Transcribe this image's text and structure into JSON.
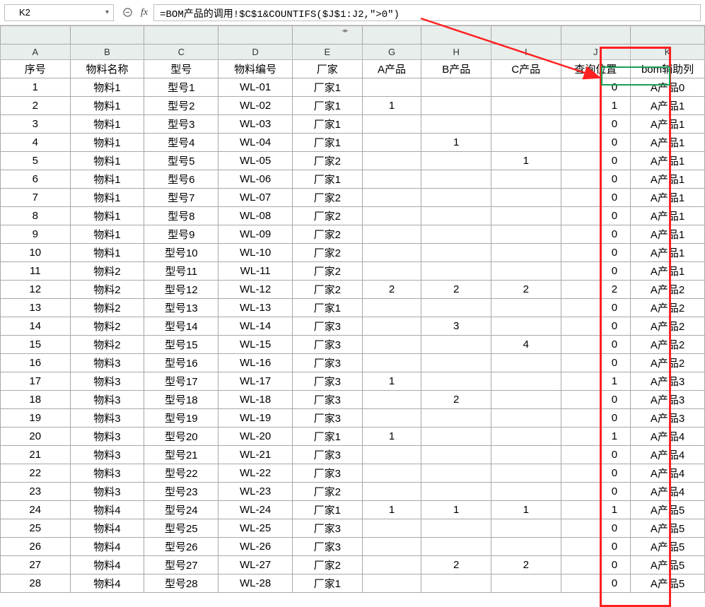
{
  "formula_bar": {
    "cell_ref": "K2",
    "fx_label": "fx",
    "formula": "=BOM产品的调用!$C$1&COUNTIFS($J$1:J2,\">0\")"
  },
  "columns": {
    "A": "A",
    "B": "B",
    "C": "C",
    "D": "D",
    "E": "E",
    "G": "G",
    "H": "H",
    "I": "I",
    "J": "J",
    "K": "K"
  },
  "headers": {
    "A": "序号",
    "B": "物料名称",
    "C": "型号",
    "D": "物料编号",
    "E": "厂家",
    "G": "A产品",
    "H": "B产品",
    "I": "C产品",
    "J": "查询位置",
    "K": "bom辅助列"
  },
  "rows": [
    {
      "A": "1",
      "B": "物料1",
      "C": "型号1",
      "D": "WL-01",
      "E": "厂家1",
      "G": "",
      "H": "",
      "I": "",
      "J": "0",
      "K": "A产品0"
    },
    {
      "A": "2",
      "B": "物料1",
      "C": "型号2",
      "D": "WL-02",
      "E": "厂家1",
      "G": "1",
      "H": "",
      "I": "",
      "J": "1",
      "K": "A产品1"
    },
    {
      "A": "3",
      "B": "物料1",
      "C": "型号3",
      "D": "WL-03",
      "E": "厂家1",
      "G": "",
      "H": "",
      "I": "",
      "J": "0",
      "K": "A产品1"
    },
    {
      "A": "4",
      "B": "物料1",
      "C": "型号4",
      "D": "WL-04",
      "E": "厂家1",
      "G": "",
      "H": "1",
      "I": "",
      "J": "0",
      "K": "A产品1"
    },
    {
      "A": "5",
      "B": "物料1",
      "C": "型号5",
      "D": "WL-05",
      "E": "厂家2",
      "G": "",
      "H": "",
      "I": "1",
      "J": "0",
      "K": "A产品1"
    },
    {
      "A": "6",
      "B": "物料1",
      "C": "型号6",
      "D": "WL-06",
      "E": "厂家1",
      "G": "",
      "H": "",
      "I": "",
      "J": "0",
      "K": "A产品1"
    },
    {
      "A": "7",
      "B": "物料1",
      "C": "型号7",
      "D": "WL-07",
      "E": "厂家2",
      "G": "",
      "H": "",
      "I": "",
      "J": "0",
      "K": "A产品1"
    },
    {
      "A": "8",
      "B": "物料1",
      "C": "型号8",
      "D": "WL-08",
      "E": "厂家2",
      "G": "",
      "H": "",
      "I": "",
      "J": "0",
      "K": "A产品1"
    },
    {
      "A": "9",
      "B": "物料1",
      "C": "型号9",
      "D": "WL-09",
      "E": "厂家2",
      "G": "",
      "H": "",
      "I": "",
      "J": "0",
      "K": "A产品1"
    },
    {
      "A": "10",
      "B": "物料1",
      "C": "型号10",
      "D": "WL-10",
      "E": "厂家2",
      "G": "",
      "H": "",
      "I": "",
      "J": "0",
      "K": "A产品1"
    },
    {
      "A": "11",
      "B": "物料2",
      "C": "型号11",
      "D": "WL-11",
      "E": "厂家2",
      "G": "",
      "H": "",
      "I": "",
      "J": "0",
      "K": "A产品1"
    },
    {
      "A": "12",
      "B": "物料2",
      "C": "型号12",
      "D": "WL-12",
      "E": "厂家2",
      "G": "2",
      "H": "2",
      "I": "2",
      "J": "2",
      "K": "A产品2"
    },
    {
      "A": "13",
      "B": "物料2",
      "C": "型号13",
      "D": "WL-13",
      "E": "厂家1",
      "G": "",
      "H": "",
      "I": "",
      "J": "0",
      "K": "A产品2"
    },
    {
      "A": "14",
      "B": "物料2",
      "C": "型号14",
      "D": "WL-14",
      "E": "厂家3",
      "G": "",
      "H": "3",
      "I": "",
      "J": "0",
      "K": "A产品2"
    },
    {
      "A": "15",
      "B": "物料2",
      "C": "型号15",
      "D": "WL-15",
      "E": "厂家3",
      "G": "",
      "H": "",
      "I": "4",
      "J": "0",
      "K": "A产品2"
    },
    {
      "A": "16",
      "B": "物料3",
      "C": "型号16",
      "D": "WL-16",
      "E": "厂家3",
      "G": "",
      "H": "",
      "I": "",
      "J": "0",
      "K": "A产品2"
    },
    {
      "A": "17",
      "B": "物料3",
      "C": "型号17",
      "D": "WL-17",
      "E": "厂家3",
      "G": "1",
      "H": "",
      "I": "",
      "J": "1",
      "K": "A产品3"
    },
    {
      "A": "18",
      "B": "物料3",
      "C": "型号18",
      "D": "WL-18",
      "E": "厂家3",
      "G": "",
      "H": "2",
      "I": "",
      "J": "0",
      "K": "A产品3"
    },
    {
      "A": "19",
      "B": "物料3",
      "C": "型号19",
      "D": "WL-19",
      "E": "厂家3",
      "G": "",
      "H": "",
      "I": "",
      "J": "0",
      "K": "A产品3"
    },
    {
      "A": "20",
      "B": "物料3",
      "C": "型号20",
      "D": "WL-20",
      "E": "厂家1",
      "G": "1",
      "H": "",
      "I": "",
      "J": "1",
      "K": "A产品4"
    },
    {
      "A": "21",
      "B": "物料3",
      "C": "型号21",
      "D": "WL-21",
      "E": "厂家3",
      "G": "",
      "H": "",
      "I": "",
      "J": "0",
      "K": "A产品4"
    },
    {
      "A": "22",
      "B": "物料3",
      "C": "型号22",
      "D": "WL-22",
      "E": "厂家3",
      "G": "",
      "H": "",
      "I": "",
      "J": "0",
      "K": "A产品4"
    },
    {
      "A": "23",
      "B": "物料3",
      "C": "型号23",
      "D": "WL-23",
      "E": "厂家2",
      "G": "",
      "H": "",
      "I": "",
      "J": "0",
      "K": "A产品4"
    },
    {
      "A": "24",
      "B": "物料4",
      "C": "型号24",
      "D": "WL-24",
      "E": "厂家1",
      "G": "1",
      "H": "1",
      "I": "1",
      "J": "1",
      "K": "A产品5"
    },
    {
      "A": "25",
      "B": "物料4",
      "C": "型号25",
      "D": "WL-25",
      "E": "厂家3",
      "G": "",
      "H": "",
      "I": "",
      "J": "0",
      "K": "A产品5"
    },
    {
      "A": "26",
      "B": "物料4",
      "C": "型号26",
      "D": "WL-26",
      "E": "厂家3",
      "G": "",
      "H": "",
      "I": "",
      "J": "0",
      "K": "A产品5"
    },
    {
      "A": "27",
      "B": "物料4",
      "C": "型号27",
      "D": "WL-27",
      "E": "厂家2",
      "G": "",
      "H": "2",
      "I": "2",
      "J": "0",
      "K": "A产品5"
    },
    {
      "A": "28",
      "B": "物料4",
      "C": "型号28",
      "D": "WL-28",
      "E": "厂家1",
      "G": "",
      "H": "",
      "I": "",
      "J": "0",
      "K": "A产品5"
    }
  ]
}
